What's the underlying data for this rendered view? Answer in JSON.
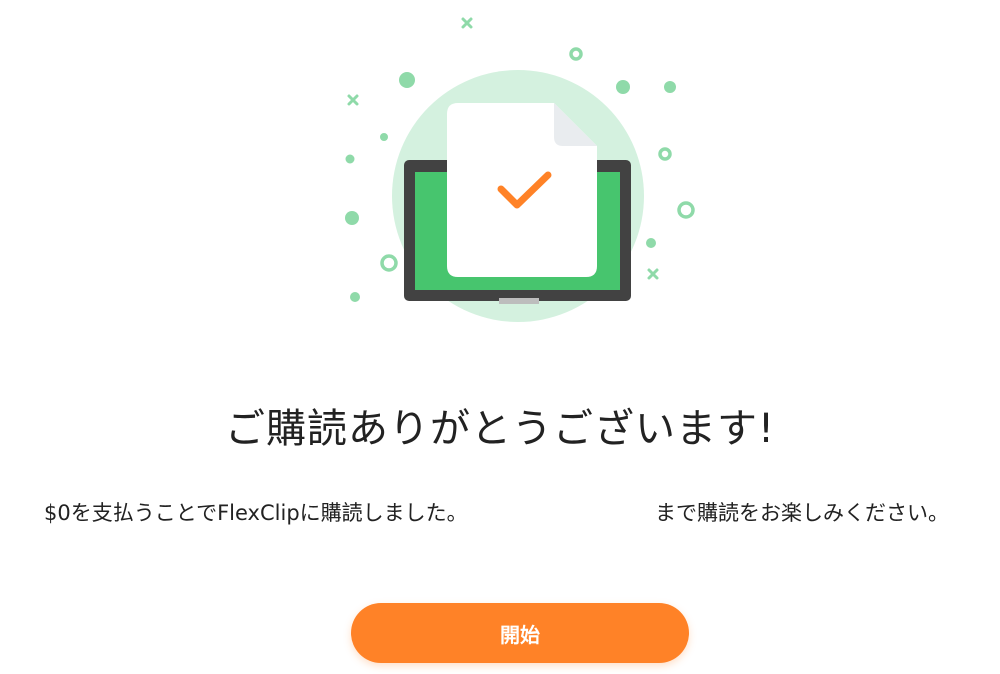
{
  "title": "ご購読ありがとうございます!",
  "message": {
    "part1": "$0を支払うことでFlexClipに購読しました。",
    "part2": "まで購読をお楽しみください。"
  },
  "start_button": {
    "label": "開始"
  },
  "colors": {
    "accent": "#ff8227",
    "screen_green": "#47c56e",
    "circle_light_green": "#d4f1df",
    "dot_green": "#8fdaa9",
    "laptop_frame": "#424242",
    "document_white": "#ffffff"
  },
  "icons": [
    "success-illustration",
    "check-icon",
    "laptop-icon",
    "document-icon"
  ]
}
